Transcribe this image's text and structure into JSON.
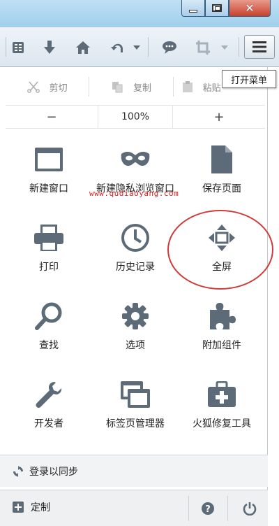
{
  "window": {
    "minimize_icon": "minimize-icon",
    "maximize_icon": "maximize-icon",
    "close_glyph": "✕"
  },
  "toolbar": {
    "icons": [
      "reader-icon",
      "download-arrow-icon",
      "home-icon",
      "undo-icon",
      "dropdown-icon",
      "speech-bubble-icon",
      "crop-icon",
      "dropdown-icon",
      "hamburger-menu-icon"
    ]
  },
  "tooltip": {
    "text": "打开菜单"
  },
  "menu": {
    "edit": {
      "cut": "剪切",
      "copy": "复制",
      "paste": "粘贴"
    },
    "zoom": {
      "minus": "−",
      "level": "100%",
      "plus": "+"
    },
    "items": [
      {
        "label": "新建窗口",
        "icon": "window-icon"
      },
      {
        "label": "新建隐私浏览窗口",
        "icon": "mask-icon"
      },
      {
        "label": "保存页面",
        "icon": "page-icon"
      },
      {
        "label": "打印",
        "icon": "printer-icon"
      },
      {
        "label": "历史记录",
        "icon": "clock-icon"
      },
      {
        "label": "全屏",
        "icon": "fullscreen-arrows-icon"
      },
      {
        "label": "查找",
        "icon": "magnifier-icon"
      },
      {
        "label": "选项",
        "icon": "gear-icon"
      },
      {
        "label": "附加组件",
        "icon": "puzzle-icon"
      },
      {
        "label": "开发者",
        "icon": "wrench-icon"
      },
      {
        "label": "标签页管理器",
        "icon": "tabs-icon"
      },
      {
        "label": "火狐修复工具",
        "icon": "toolbox-icon"
      }
    ],
    "sync": "登录以同步",
    "customize": "定制"
  },
  "watermark": "www.qudiaoyang.com",
  "colors": {
    "icon": "#5d6b78",
    "annotation": "#d23a3a",
    "watermark": "#e02020"
  }
}
